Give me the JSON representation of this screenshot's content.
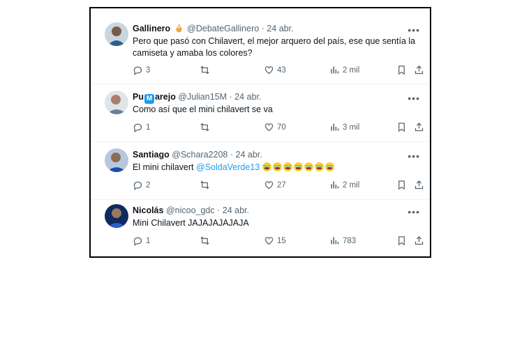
{
  "tweets": [
    {
      "name": "Gallinero",
      "handle": "@DebateGallinero",
      "date": "24 abr.",
      "text": "Pero que pasó con Chilavert, el mejor arquero del país, ese que sentía la camiseta y amaba los colores?",
      "replies": "3",
      "likes": "43",
      "views": "2 mil",
      "avatar_color": "#2b5f8a",
      "name_badge_icon": "rooster-emoji"
    },
    {
      "name_pre": "Pu",
      "name_badge": "M",
      "name_post": "arejo",
      "handle": "@Julian15M",
      "date": "24 abr.",
      "text": "Como así que el mini chilavert se va",
      "replies": "1",
      "likes": "70",
      "views": "3 mil",
      "avatar_color": "#6b7f96"
    },
    {
      "name": "Santiago",
      "handle": "@Schara2208",
      "date": "24 abr.",
      "text": "El mini chilavert ",
      "mention": "@SoldaVerde13",
      "emoji_count": 7,
      "emoji_icon": "loudly-crying-face-emoji",
      "replies": "2",
      "likes": "27",
      "views": "2 mil",
      "avatar_color": "#1e4ea8"
    },
    {
      "name": "Nicolás",
      "handle": "@nicoo_gdc",
      "date": "24 abr.",
      "text": "Mini Chilavert JAJAJAJAJAJA",
      "replies": "1",
      "likes": "15",
      "views": "783",
      "avatar_color": "#17377a"
    }
  ],
  "ui": {
    "separator": "·",
    "more": "•••"
  },
  "colors": {
    "text": "#0f1419",
    "secondary": "#536471",
    "link": "#1d9bf0",
    "divider": "#eff3f4"
  }
}
